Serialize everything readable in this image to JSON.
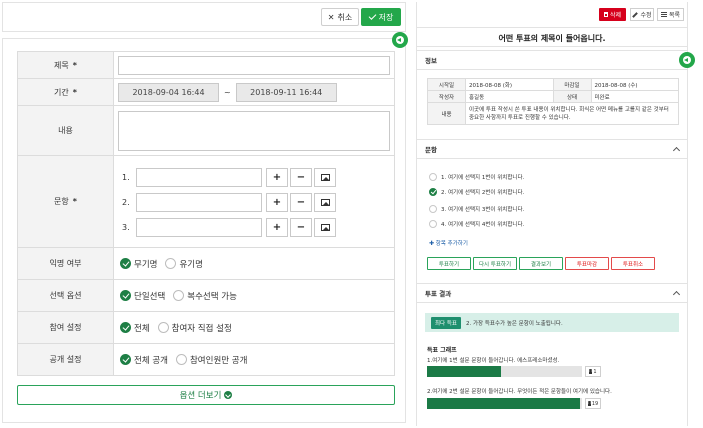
{
  "left": {
    "cancel_label": "취소",
    "save_label": "저장",
    "title_label": "제목",
    "period_label": "기간",
    "start_date": "2018-09-04 16:44",
    "end_date": "2018-09-11 16:44",
    "period_sep": "~",
    "content_label": "내용",
    "options_label": "문항",
    "options": [
      {
        "num": "1."
      },
      {
        "num": "2."
      },
      {
        "num": "3."
      }
    ],
    "plus_glyph": "+",
    "minus_glyph": "−",
    "anonymous_label": "익명 여부",
    "anonymous_opts": [
      "무기명",
      "유기명"
    ],
    "select_label": "선택 옵션",
    "select_opts": [
      "단일선택",
      "복수선택 가능"
    ],
    "participation_label": "참여 설정",
    "participation_opts": [
      "전체",
      "참여자 직접 설정"
    ],
    "public_label": "공개 설정",
    "public_opts": [
      "전체 공개",
      "참여인원만 공개"
    ],
    "more_label": "옵션 더보기",
    "required_mark": "*"
  },
  "right": {
    "delete_label": "삭제",
    "edit_label": "수정",
    "list_label": "목록",
    "vote_title": "어떤 투표의 제목이 들어옵니다.",
    "info_section": "정보",
    "info": {
      "start_k": "시작일",
      "start_v": "2018-08-08 (화)",
      "end_k": "마감일",
      "end_v": "2018-08-08 (수)",
      "author_k": "작성자",
      "author_v": "홍길동",
      "status_k": "상태",
      "status_v": "미완료",
      "content_k": "내용",
      "content_v": "이곳에 투표 작성시 쓴 투표 내용이 위치합니다. 회식은 어떤 메뉴를 고를지 같은 것부터 중요한 사항까지 투표로 진행할 수 있습니다."
    },
    "items_section": "문항",
    "items": [
      "1. 여기에 선택지 1번이 위치합니다.",
      "2. 여기에 선택지 2번이 위치합니다.",
      "3. 여기에 선택지 3번이 위치합니다.",
      "4. 여기에 선택지 4번이 위치합니다."
    ],
    "selected_item": 1,
    "add_item": "항목 추가하기",
    "actions": [
      "투표하기",
      "다시 투표하기",
      "결과보기",
      "투표마감",
      "투표취소"
    ],
    "result_section": "투표 결과",
    "result_badge": "최다 득표",
    "result_text": "2. 가장 득표수가 높은 문항이 노출됩니다.",
    "graph_title": "득표 그래프",
    "graph": [
      {
        "question": "1.여기에 1번 설문 문항이 들어갑니다. 에스프레소마셨성.",
        "count": "1",
        "fraction": 0.48
      },
      {
        "question": "2.여기에 2번 설문 문항이 들어갑니다. 무엇이든 적은 문항들이 여기에 있습니다.",
        "count": "19",
        "fraction": 0.99
      }
    ]
  }
}
